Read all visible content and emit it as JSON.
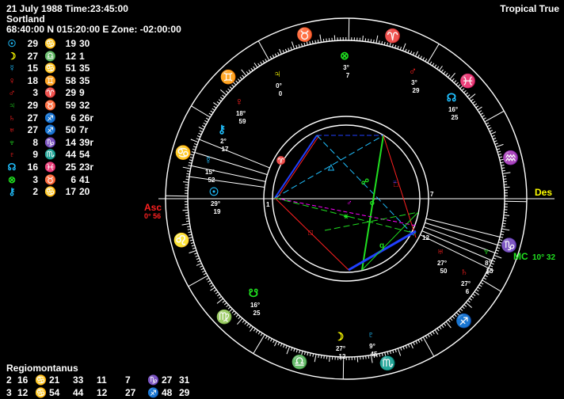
{
  "header": {
    "date_line": "21 July 1988 Time:23:45:00",
    "name_line": "Sortland",
    "coord_line": "68:40:00 N 015:20:00 E Zone: -02:00:00",
    "system_label": "Tropical True"
  },
  "colors": {
    "fire": "#ff2020",
    "earth": "#20e020",
    "air": "#ffff00",
    "water": "#20c0ff",
    "white": "#ffffff",
    "magenta": "#ff00ff",
    "blue": "#2040ff"
  },
  "planets": [
    {
      "glyph": "☉",
      "glyph_color": "#20c0ff",
      "deg": "29",
      "sign": "♋",
      "sign_color": "#20c0ff",
      "min": "19",
      "extra": "30"
    },
    {
      "glyph": "☽",
      "glyph_color": "#ffff00",
      "deg": "27",
      "sign": "♎",
      "sign_color": "#ffff00",
      "min": "12",
      "extra": "1"
    },
    {
      "glyph": "☿",
      "glyph_color": "#20c0ff",
      "deg": "15",
      "sign": "♋",
      "sign_color": "#20c0ff",
      "min": "51",
      "extra": "35"
    },
    {
      "glyph": "♀",
      "glyph_color": "#ff2020",
      "deg": "18",
      "sign": "♊",
      "sign_color": "#ffff00",
      "min": "58",
      "extra": "35"
    },
    {
      "glyph": "♂",
      "glyph_color": "#ff2020",
      "deg": "3",
      "sign": "♈",
      "sign_color": "#ff2020",
      "min": "29",
      "extra": "9"
    },
    {
      "glyph": "♃",
      "glyph_color": "#20e020",
      "deg": "29",
      "sign": "♉",
      "sign_color": "#20e020",
      "min": "59",
      "extra": "32"
    },
    {
      "glyph": "♄",
      "glyph_color": "#ff2020",
      "deg": "27",
      "sign": "♐",
      "sign_color": "#ff2020",
      "min": "6",
      "extra": "26r"
    },
    {
      "glyph": "♅",
      "glyph_color": "#ff2020",
      "deg": "27",
      "sign": "♐",
      "sign_color": "#ff2020",
      "min": "50",
      "extra": "7r"
    },
    {
      "glyph": "♆",
      "glyph_color": "#20e020",
      "deg": "8",
      "sign": "♑",
      "sign_color": "#20e020",
      "min": "14",
      "extra": "39r"
    },
    {
      "glyph": "♇",
      "glyph_color": "#ff2020",
      "deg": "9",
      "sign": "♏",
      "sign_color": "#20c0ff",
      "min": "44",
      "extra": "54"
    },
    {
      "glyph": "☊",
      "glyph_color": "#20c0ff",
      "deg": "16",
      "sign": "♓",
      "sign_color": "#20c0ff",
      "min": "25",
      "extra": "23r"
    },
    {
      "glyph": "⊗",
      "glyph_color": "#20e020",
      "deg": "3",
      "sign": "♉",
      "sign_color": "#20e020",
      "min": "6",
      "extra": "41"
    },
    {
      "glyph": "⚷",
      "glyph_color": "#20c0ff",
      "deg": "2",
      "sign": "♋",
      "sign_color": "#20c0ff",
      "min": "17",
      "extra": "20"
    }
  ],
  "house_system": {
    "title": "Regiomontanus",
    "rows": [
      {
        "h1": "2",
        "d1": "16",
        "s1": "♋",
        "c1": "#20c0ff",
        "m1": "21",
        "h2": "33",
        "d2": "11",
        "x2": "7",
        "s2": "♑",
        "c2": "#20e020",
        "m2": "27",
        "t2": "31"
      },
      {
        "h1": "3",
        "d1": "12",
        "s1": "♋",
        "c1": "#20c0ff",
        "m1": "54",
        "h2": "44",
        "d2": "12",
        "x2": "27",
        "s2": "♐",
        "c2": "#ff2020",
        "m2": "48",
        "t2": "29"
      }
    ]
  },
  "wheel": {
    "asc_label": "Asc",
    "asc_deg": "0° 56",
    "des_label": "Des",
    "mc_label": "MC",
    "mc_deg": "10° 32",
    "ring_signs": [
      "♉",
      "♈",
      "♓",
      "♒",
      "♑",
      "♐",
      "♏",
      "♎",
      "♍",
      "♌",
      "♋",
      "♊"
    ],
    "ring_sign_colors": [
      "#20e020",
      "#ff2020",
      "#20c0ff",
      "#ffff00",
      "#20e020",
      "#ff2020",
      "#20c0ff",
      "#ffff00",
      "#20e020",
      "#ff2020",
      "#20c0ff",
      "#ffff00"
    ],
    "house_numbers": [
      "1",
      "7",
      "12"
    ],
    "planet_labels": [
      {
        "glyph": "⊗",
        "color": "#20e020",
        "l1": "3°",
        "l2": "7"
      },
      {
        "glyph": "♃",
        "color": "#ffff00",
        "l1": "0°",
        "l2": "0"
      },
      {
        "glyph": "♂",
        "color": "#ff2020",
        "l1": "3°",
        "l2": "29"
      },
      {
        "glyph": "☊",
        "color": "#20c0ff",
        "l1": "16°",
        "l2": "25"
      },
      {
        "glyph": "♀",
        "color": "#ff2020",
        "l1": "18°",
        "l2": "59"
      },
      {
        "glyph": "⚷",
        "color": "#20c0ff",
        "l1": "2°",
        "l2": "17"
      },
      {
        "glyph": "☿",
        "color": "#20c0ff",
        "l1": "15°",
        "l2": "52"
      },
      {
        "glyph": "☉",
        "color": "#20c0ff",
        "l1": "29°",
        "l2": "19"
      },
      {
        "glyph": "♆",
        "color": "#20e020",
        "l1": "8°",
        "l2": "15"
      },
      {
        "glyph": "♅",
        "color": "#ff2020",
        "l1": "27°",
        "l2": "50"
      },
      {
        "glyph": "♄",
        "color": "#ff2020",
        "l1": "27°",
        "l2": "6"
      },
      {
        "glyph": "☋",
        "color": "#20e020",
        "l1": "16°",
        "l2": "25"
      },
      {
        "glyph": "☽",
        "color": "#ffff00",
        "l1": "27°",
        "l2": "12"
      },
      {
        "glyph": "♇",
        "color": "#20c0ff",
        "l1": "9°",
        "l2": "45"
      }
    ],
    "aspect_markers": [
      "△",
      "☍",
      "☌",
      "□",
      "♂",
      "⚹",
      "□",
      "♃",
      "♈",
      "q"
    ]
  }
}
